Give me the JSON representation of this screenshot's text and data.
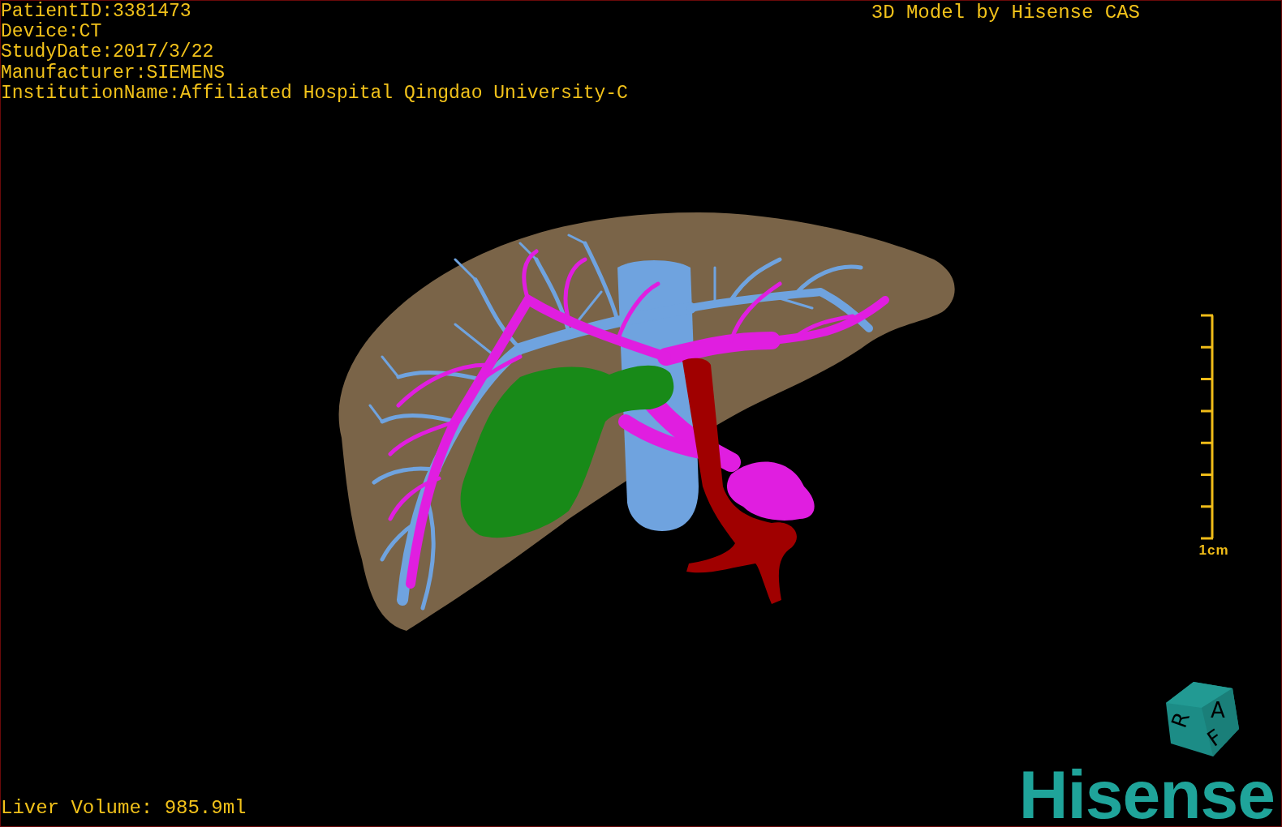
{
  "patient_info": [
    "PatientID:3381473",
    "Device:CT",
    "StudyDate:2017/3/22",
    "Manufacturer:SIEMENS",
    "InstitutionName:Affiliated Hospital Qingdao University-C"
  ],
  "title": "3D Model by Hisense CAS",
  "scale_bar": {
    "label": "1cm"
  },
  "volume": "Liver Volume: 985.9ml",
  "orientation_cube": {
    "faces": [
      "A",
      "R",
      "F"
    ]
  },
  "logo": "Hisense"
}
